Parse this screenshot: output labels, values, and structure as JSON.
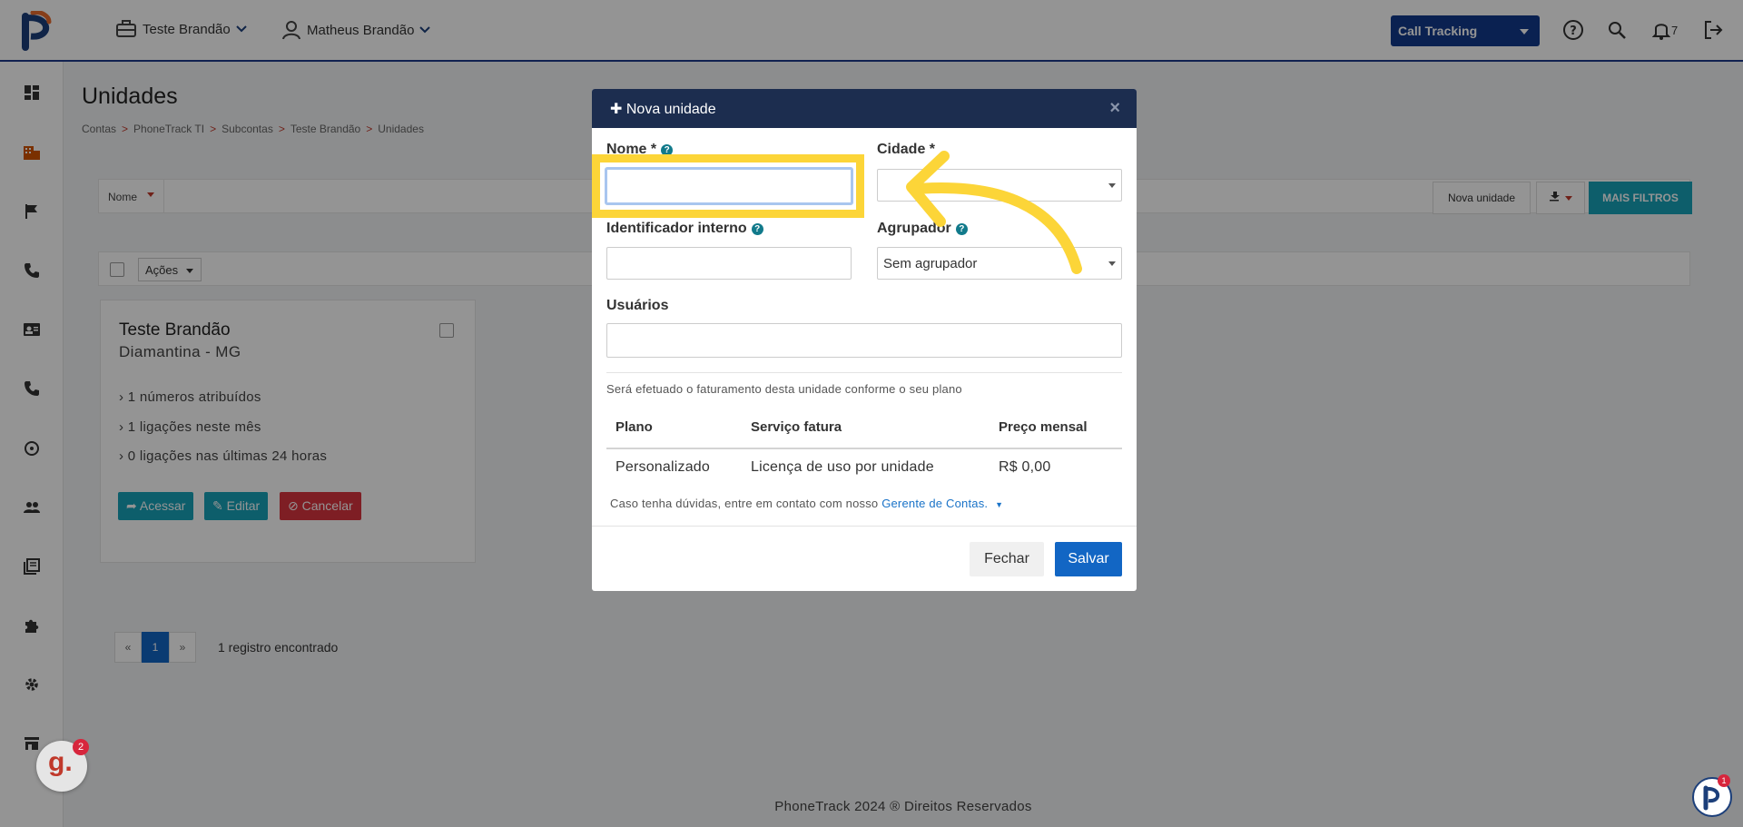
{
  "topbar": {
    "account": "Teste Brandão",
    "user": "Matheus Brandão",
    "product_select": "Call Tracking",
    "notifications_count": "7"
  },
  "page": {
    "title": "Unidades",
    "breadcrumb": [
      "Contas",
      "PhoneTrack TI",
      "Subcontas",
      "Teste Brandão",
      "Unidades"
    ],
    "breadcrumb_sep": ">"
  },
  "filters": {
    "field": "Nome",
    "nova_unidade": "Nova unidade",
    "mais_filtros": "MAIS FILTROS",
    "acoes": "Ações"
  },
  "card": {
    "title": "Teste Brandão",
    "location": "Diamantina - MG",
    "stats": [
      "1 números atribuídos",
      "1 ligações neste mês",
      "0 ligações nas últimas 24 horas"
    ],
    "buttons": {
      "acessar": "Acessar",
      "editar": "Editar",
      "cancelar": "Cancelar"
    }
  },
  "pagination": {
    "prev": "«",
    "current": "1",
    "next": "»",
    "summary": "1 registro encontrado"
  },
  "footer": "PhoneTrack 2024 ® Direitos Reservados",
  "modal": {
    "title": "Nova unidade",
    "close": "×",
    "labels": {
      "nome": "Nome *",
      "cidade": "Cidade *",
      "identificador": "Identificador interno",
      "agrupador": "Agrupador",
      "usuarios": "Usuários"
    },
    "agrupador_value": "Sem agrupador",
    "note": "Será efetuado o faturamento desta unidade conforme o seu plano",
    "table": {
      "headers": [
        "Plano",
        "Serviço fatura",
        "Preço mensal"
      ],
      "row": [
        "Personalizado",
        "Licença de uso por unidade",
        "R$ 0,00"
      ]
    },
    "help_text": "Caso tenha dúvidas, entre em contato com nosso",
    "help_link": "Gerente de Contas.",
    "fechar": "Fechar",
    "salvar": "Salvar"
  },
  "widgets": {
    "chat_letter": "g.",
    "chat_badge": "2",
    "help_badge": "1"
  },
  "colors": {
    "brand": "#123a8c",
    "accent_teal": "#17a2b8",
    "primary_blue": "#1266c4",
    "modal_header": "#1c2d4f",
    "highlight": "#fcd538",
    "danger": "#d9343f"
  }
}
